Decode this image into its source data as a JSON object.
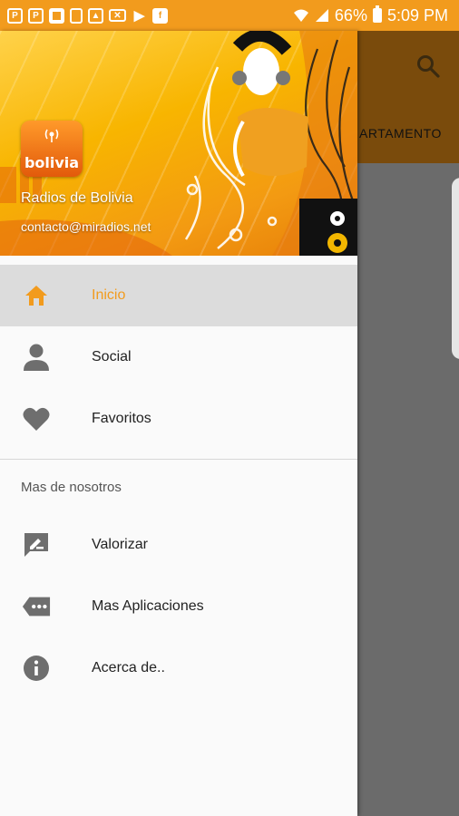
{
  "status_bar": {
    "left_icons": [
      "chat-app-icon",
      "chat-app-icon",
      "flipboard-icon",
      "screenshot-icon",
      "photo-icon",
      "mail-icon",
      "play-store-icon",
      "facebook-icon"
    ],
    "battery": "66%",
    "time": "5:09 PM"
  },
  "background": {
    "toolbar_text": "ARTAMENTO"
  },
  "drawer": {
    "header": {
      "logo_text": "bolivia",
      "title": "Radios de Bolivia",
      "email": "contacto@miradios.net"
    },
    "items": [
      {
        "label": "Inicio",
        "icon": "home-icon",
        "active": true
      },
      {
        "label": "Social",
        "icon": "person-icon",
        "active": false
      },
      {
        "label": "Favoritos",
        "icon": "heart-icon",
        "active": false
      }
    ],
    "section_title": "Mas de nosotros",
    "more_items": [
      {
        "label": "Valorizar",
        "icon": "rate-review-icon"
      },
      {
        "label": "Mas Aplicaciones",
        "icon": "more-apps-icon"
      },
      {
        "label": "Acerca de..",
        "icon": "info-icon"
      }
    ]
  },
  "colors": {
    "accent": "#f29b1d",
    "status_bar": "#f29b1d",
    "active_row": "#dcdcdc",
    "icon_gray": "#6e6e6e",
    "scrim": "#6b6b6b"
  }
}
